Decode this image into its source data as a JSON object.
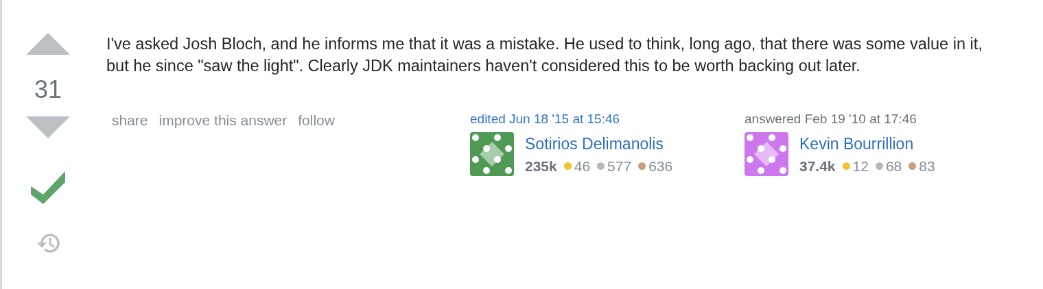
{
  "vote": {
    "score": "31",
    "accepted": true
  },
  "body": "I've asked Josh Bloch, and he informs me that it was a mistake. He used to think, long ago, that there was some value in it, but he since \"saw the light\". Clearly JDK maintainers haven't considered this to be worth backing out later.",
  "post_menu": [
    "share",
    "improve this answer",
    "follow"
  ],
  "signatures": [
    {
      "kind": "edited",
      "action": "edited Jun 18 '15 at 15:46",
      "user": "Sotirios Delimanolis",
      "color": "#4e9a55",
      "reputation": "235k",
      "badges": [
        {
          "kind": "gold",
          "count": "46"
        },
        {
          "kind": "silver",
          "count": "577"
        },
        {
          "kind": "bronze",
          "count": "636"
        }
      ]
    },
    {
      "kind": "answered",
      "action": "answered Feb 19 '10 at 17:46",
      "user": "Kevin Bourrillion",
      "color": "#cc77ee",
      "reputation": "37.4k",
      "badges": [
        {
          "kind": "gold",
          "count": "12"
        },
        {
          "kind": "silver",
          "count": "68"
        },
        {
          "kind": "bronze",
          "count": "83"
        }
      ]
    }
  ]
}
